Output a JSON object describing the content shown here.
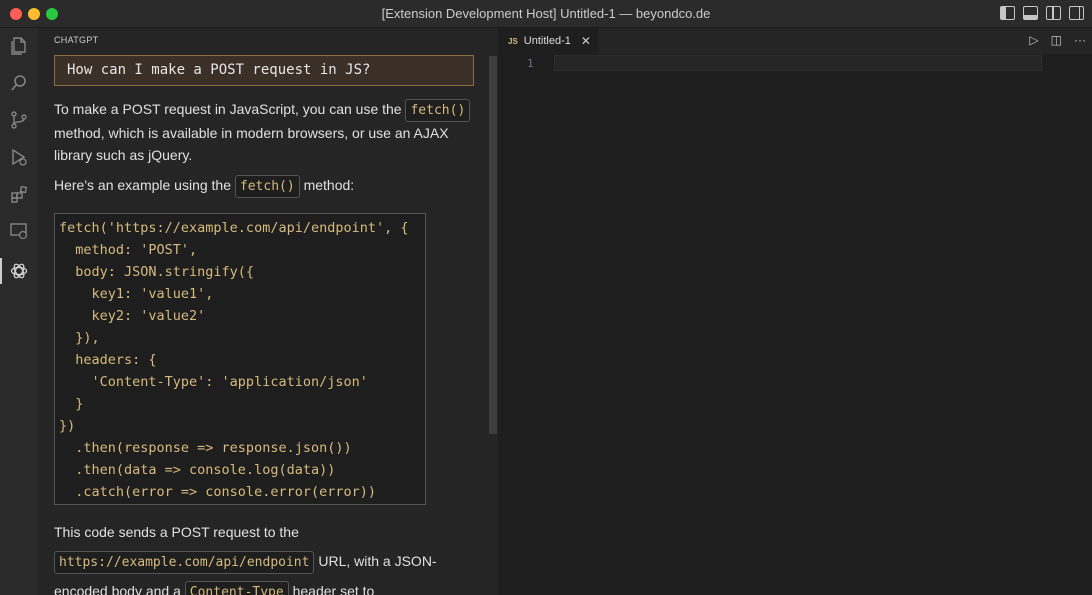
{
  "window": {
    "title": "[Extension Development Host] Untitled-1 — beyondco.de"
  },
  "panel": {
    "title": "CHATGPT",
    "question": "How can I make a POST request in JS?",
    "answer": {
      "p1_a": "To make a POST request in JavaScript, you can use the ",
      "p1_code": "fetch()",
      "p1_b": " method, which is available in modern browsers, or use an AJAX library such as jQuery.",
      "p2_a": "Here's an example using the ",
      "p2_code": "fetch()",
      "p2_b": " method:",
      "code": "fetch('https://example.com/api/endpoint', {\n  method: 'POST',\n  body: JSON.stringify({\n    key1: 'value1',\n    key2: 'value2'\n  }),\n  headers: {\n    'Content-Type': 'application/json'\n  }\n})\n  .then(response => response.json())\n  .then(data => console.log(data))\n  .catch(error => console.error(error))",
      "p3_a": "This code sends a POST request to the ",
      "p3_code1": "https://example.com/api/endpoint",
      "p3_b": " URL, with a JSON-encoded body and a ",
      "p3_code2": "Content-Type",
      "p3_c": " header set to"
    }
  },
  "editor": {
    "tab_lang": "JS",
    "tab_label": "Untitled-1",
    "tab_close": "✕",
    "run_icon": "▷",
    "split_icon": "◫",
    "more_icon": "···",
    "line_number": "1"
  },
  "icons": {
    "activity": [
      "files-icon",
      "search-icon",
      "source-control-icon",
      "run-debug-icon",
      "extensions-icon",
      "remote-explorer-icon",
      "chatgpt-icon"
    ]
  }
}
